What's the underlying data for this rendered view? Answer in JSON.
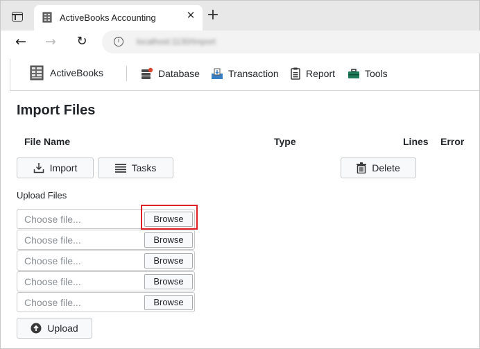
{
  "browser": {
    "tab_title": "ActiveBooks Accounting",
    "tab_close": "✕",
    "new_tab": "+",
    "url": "localhost:1130/Import"
  },
  "navbar": {
    "brand": "ActiveBooks",
    "items": [
      {
        "label": "Database",
        "icon": "database-icon"
      },
      {
        "label": "Transaction",
        "icon": "transaction-icon"
      },
      {
        "label": "Report",
        "icon": "report-icon"
      },
      {
        "label": "Tools",
        "icon": "toolbox-icon"
      }
    ]
  },
  "page": {
    "title": "Import Files",
    "columns": [
      "File Name",
      "Type",
      "Lines",
      "Error"
    ],
    "actions": {
      "import": "Import",
      "tasks": "Tasks",
      "delete": "Delete"
    },
    "upload": {
      "label": "Upload Files",
      "placeholder": "Choose file...",
      "browse": "Browse",
      "submit": "Upload",
      "rows": 5
    }
  },
  "colors": {
    "highlight": "#e01e25",
    "button_bg": "#f8f9fa",
    "border": "#c6c8ca"
  }
}
